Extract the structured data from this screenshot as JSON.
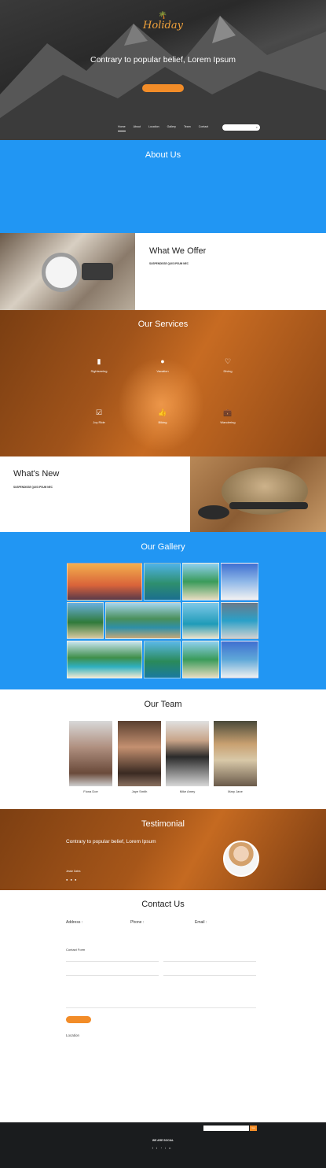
{
  "hero": {
    "logo_text": "Holiday",
    "heading": "Contrary to popular belief, Lorem Ipsum",
    "nav": [
      "Home",
      "About",
      "Location",
      "Gallery",
      "Team",
      "Contact"
    ]
  },
  "about": {
    "title": "About Us"
  },
  "offer": {
    "title": "What We Offer",
    "subheading": "SUSPENDISSE QUIS IPSUM NEC"
  },
  "services": {
    "title": "Our Services",
    "items": [
      {
        "label": "Sightseeing",
        "icon": "bar-chart-icon"
      },
      {
        "label": "Vacation",
        "icon": "user-icon"
      },
      {
        "label": "Diving",
        "icon": "heart-icon"
      },
      {
        "label": "Joy Ride",
        "icon": "check-square-icon"
      },
      {
        "label": "Biking",
        "icon": "thumbs-up-icon"
      },
      {
        "label": "Wandering",
        "icon": "briefcase-icon"
      }
    ]
  },
  "whats_new": {
    "title": "What's New",
    "subheading": "SUSPENDISSE QUIS IPSUM NEC"
  },
  "gallery": {
    "title": "Our Gallery"
  },
  "team": {
    "title": "Our Team",
    "members": [
      {
        "name": "Fiona Doe"
      },
      {
        "name": "Jaye Smith"
      },
      {
        "name": "Mike Amey"
      },
      {
        "name": "Mary Jane"
      }
    ]
  },
  "testimonial": {
    "title": "Testimonial",
    "quote_title": "Contrary to popular belief, Lorem Ipsum",
    "author": "Jessie Gates",
    "dots": "● ● ●"
  },
  "contact": {
    "title": "Contact Us",
    "address_label": "Address :",
    "phone_label": "Phone :",
    "email_label": "Email :",
    "form_title": "Contact Form",
    "location_label": "Location"
  },
  "footer": {
    "social_title": "WE ARE SOCIAL",
    "go_label": "Go"
  },
  "colors": {
    "accent": "#f28c28",
    "blue": "#2196f3",
    "brown": "#a0531a",
    "footer": "#1a1c1e"
  }
}
